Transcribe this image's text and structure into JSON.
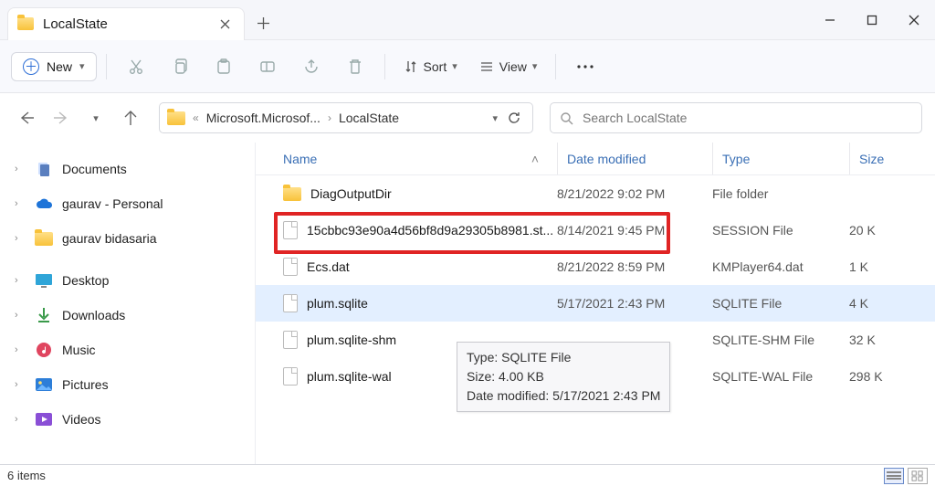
{
  "window": {
    "title": "LocalState"
  },
  "toolbar": {
    "new_label": "New",
    "sort_label": "Sort",
    "view_label": "View"
  },
  "breadcrumb": {
    "seg1": "Microsoft.Microsof...",
    "seg2": "LocalState"
  },
  "search": {
    "placeholder": "Search LocalState"
  },
  "sidebar": {
    "items": [
      {
        "label": "Documents"
      },
      {
        "label": "gaurav - Personal"
      },
      {
        "label": "gaurav bidasaria"
      },
      {
        "label": "Desktop"
      },
      {
        "label": "Downloads"
      },
      {
        "label": "Music"
      },
      {
        "label": "Pictures"
      },
      {
        "label": "Videos"
      }
    ]
  },
  "columns": {
    "name": "Name",
    "date": "Date modified",
    "type": "Type",
    "size": "Size"
  },
  "rows": [
    {
      "name": "DiagOutputDir",
      "date": "8/21/2022 9:02 PM",
      "type": "File folder",
      "size": "",
      "kind": "folder"
    },
    {
      "name": "15cbbc93e90a4d56bf8d9a29305b8981.st...",
      "date": "8/14/2021 9:45 PM",
      "type": "SESSION File",
      "size": "20 K",
      "kind": "file"
    },
    {
      "name": "Ecs.dat",
      "date": "8/21/2022 8:59 PM",
      "type": "KMPlayer64.dat",
      "size": "1 K",
      "kind": "file"
    },
    {
      "name": "plum.sqlite",
      "date": "5/17/2021 2:43 PM",
      "type": "SQLITE File",
      "size": "4 K",
      "kind": "file",
      "selected": true
    },
    {
      "name": "plum.sqlite-shm",
      "date": "",
      "type": "SQLITE-SHM File",
      "size": "32 K",
      "kind": "file"
    },
    {
      "name": "plum.sqlite-wal",
      "date": "",
      "type": "SQLITE-WAL File",
      "size": "298 K",
      "kind": "file"
    }
  ],
  "tooltip": {
    "line1": "Type: SQLITE File",
    "line2": "Size: 4.00 KB",
    "line3": "Date modified: 5/17/2021 2:43 PM"
  },
  "statusbar": {
    "count_label": "6 items"
  }
}
